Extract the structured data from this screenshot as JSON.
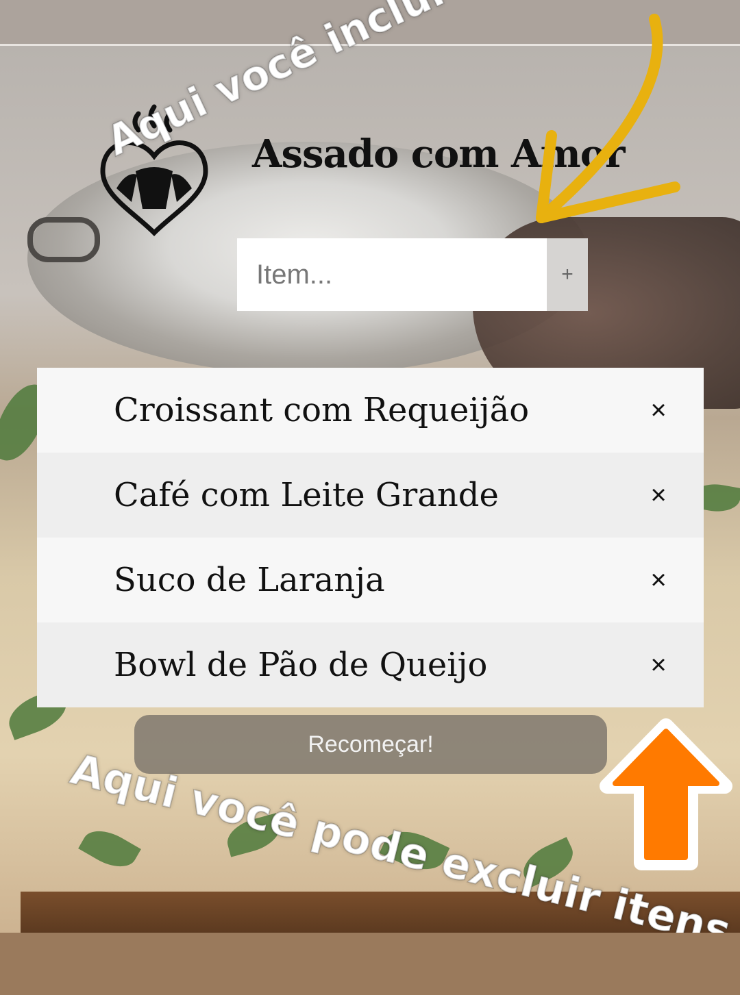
{
  "app": {
    "title": "Assado com Amor"
  },
  "input": {
    "placeholder": "Item...",
    "add_label": "+"
  },
  "items": [
    {
      "label": "Croissant com Requeijão",
      "remove_label": "×"
    },
    {
      "label": "Café com Leite Grande",
      "remove_label": "×"
    },
    {
      "label": "Suco de Laranja",
      "remove_label": "×"
    },
    {
      "label": "Bowl de Pão de Queijo",
      "remove_label": "×"
    }
  ],
  "reset_button": {
    "label": "Recomeçar!"
  },
  "annotations": {
    "top": "Aqui você inclui seus itens",
    "bottom": "Aqui você pode excluir itens"
  },
  "colors": {
    "arrow_top": "#e8b10f",
    "arrow_bottom": "#ff7a00"
  }
}
